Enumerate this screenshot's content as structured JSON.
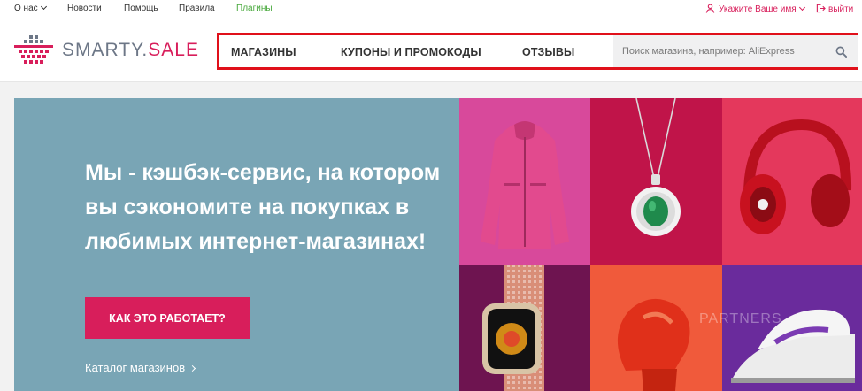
{
  "topbar": {
    "about": "О нас",
    "news": "Новости",
    "help": "Помощь",
    "rules": "Правила",
    "plugins": "Плагины",
    "user": "Укажите Ваше имя",
    "logout": "выйти"
  },
  "header": {
    "logo_main": "SMARTY.",
    "logo_accent": "SALE",
    "nav": {
      "stores": "МАГАЗИНЫ",
      "coupons": "КУПОНЫ И ПРОМОКОДЫ",
      "reviews": "ОТЗЫВЫ"
    },
    "search_placeholder": "Поиск магазина, например: AliExpress"
  },
  "hero": {
    "title": "Мы - кэшбэк-сервис, на котором вы сэкономите на покупках в любимых интернет-магазинах!",
    "cta": "КАК ЭТО РАБОТАЕТ?",
    "catalog_link": "Каталог магазинов"
  },
  "tiles": [
    {
      "name": "jacket",
      "bg": "#d8499b"
    },
    {
      "name": "pendant",
      "bg": "#c01449"
    },
    {
      "name": "headphones",
      "bg": "#e4385c"
    },
    {
      "name": "watch",
      "bg": "#6e1450"
    },
    {
      "name": "boxing-glove",
      "bg": "#f05a3b"
    },
    {
      "name": "iron",
      "bg": "#6a2b9c"
    }
  ],
  "colors": {
    "accent": "#d81e5b",
    "green_link": "#46a83a",
    "hero_bg": "#79a5b5",
    "nav_highlight": "#e0101a"
  }
}
